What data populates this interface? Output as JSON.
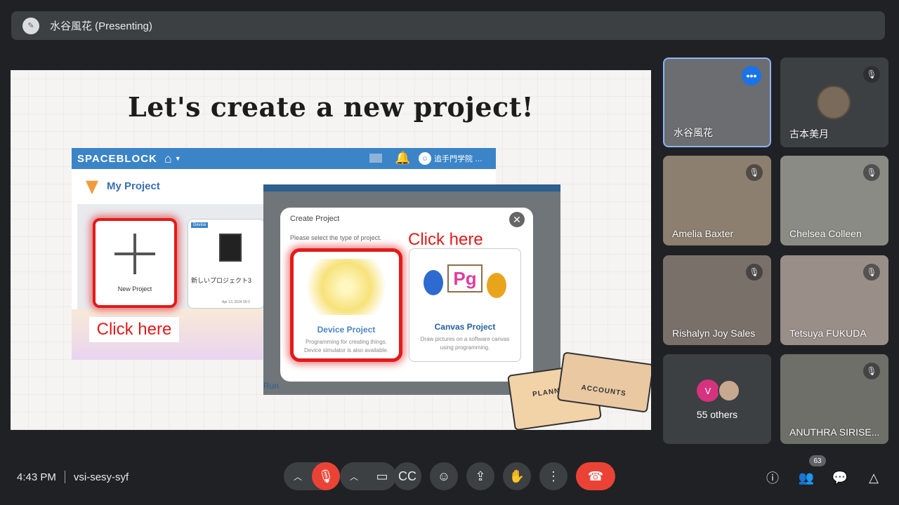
{
  "topbar": {
    "presenter_initial": "✎",
    "presenter_label": "水谷風花 (Presenting)"
  },
  "slide": {
    "title": "Let's create a new project!",
    "app": {
      "brand": "SPACEBLOCK",
      "school": "追手門学院 …",
      "my_project": "My Project",
      "new_project": "New Project",
      "device_badge": "Device",
      "device_project_name": "新しいプロジェクト3",
      "device_project_date": "Apr 13, 2024 09:3",
      "click_here_left": "Click here"
    },
    "dialog": {
      "title": "Create Project",
      "subtitle": "Please select the type of project.",
      "click_here_right": "Click here",
      "device_label": "Device Project",
      "device_desc": "Programming for creating things. Device simulator is also available.",
      "canvas_label": "Canvas Project",
      "canvas_desc": "Draw pictures on a software canvas using programming.",
      "canvas_glyph": "Pg",
      "run_label": "Run"
    },
    "books": {
      "planner": "PLANNER",
      "accounts": "ACCOUNTS"
    }
  },
  "participants": [
    {
      "name": "水谷風花",
      "muted": false,
      "pinned_speaker": true
    },
    {
      "name": "古本美月",
      "muted": true
    },
    {
      "name": "Amelia Baxter",
      "muted": true
    },
    {
      "name": "Chelsea Colleen",
      "muted": true
    },
    {
      "name": "Rishalyn Joy Sales",
      "muted": true
    },
    {
      "name": "Tetsuya FUKUDA",
      "muted": true
    },
    {
      "name": "ANUTHRA SIRISE...",
      "muted": true
    }
  ],
  "others": {
    "label": "55 others",
    "avatar_letter": "V"
  },
  "bottom": {
    "time": "4:43 PM",
    "meeting_code": "vsi-sesy-syf",
    "people_count": "63"
  },
  "colors": {
    "background": "#202124",
    "tile": "#3c4043",
    "danger": "#ea4335",
    "accent": "#1a73e8"
  }
}
